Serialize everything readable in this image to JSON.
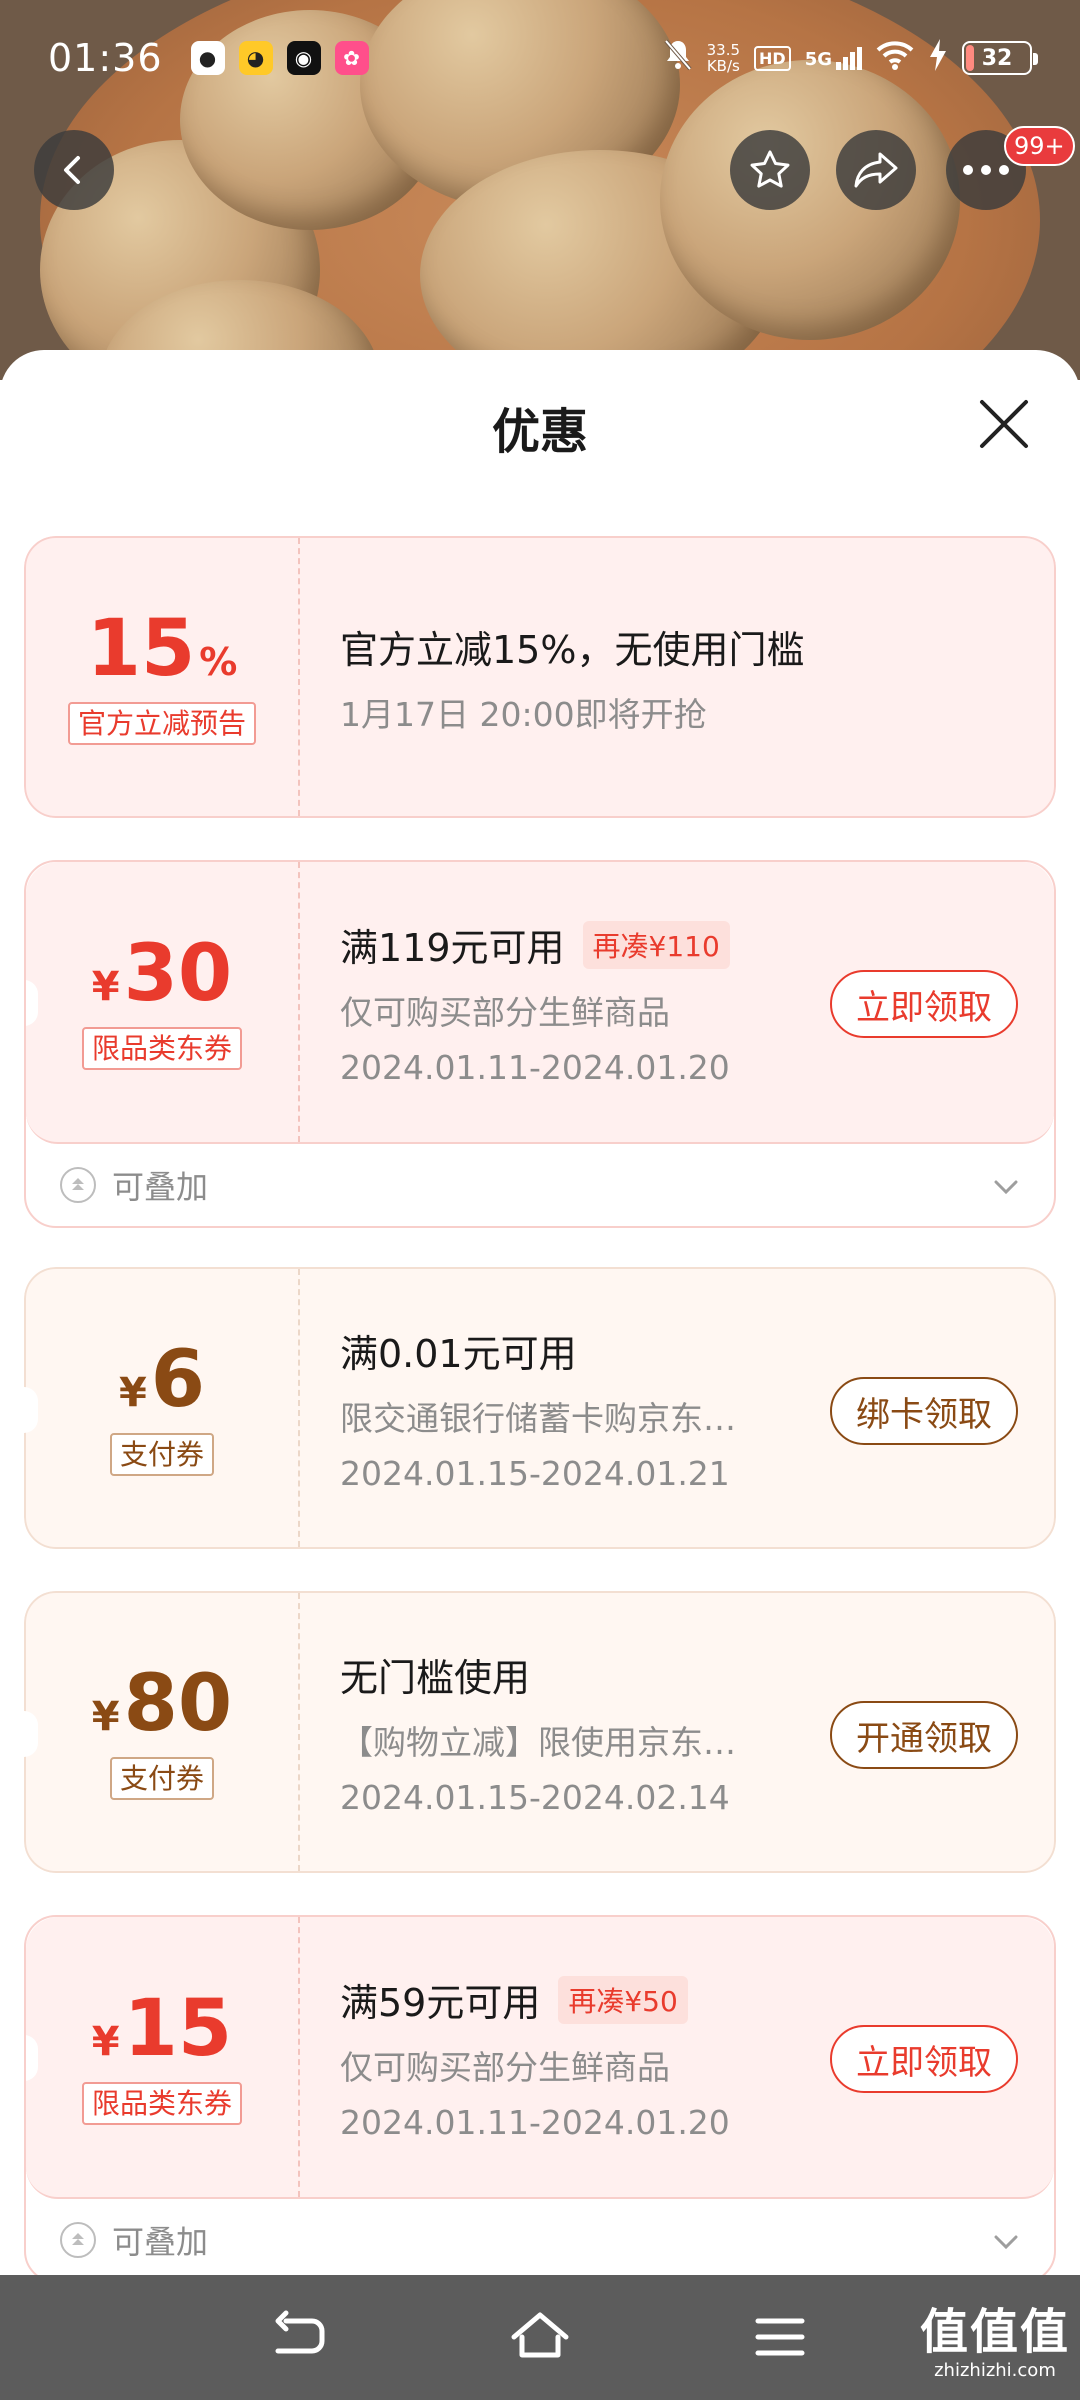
{
  "status_bar": {
    "time": "01:36",
    "net_speed_value": "33.5",
    "net_speed_unit": "KB/s",
    "hd": "HD",
    "signal": "5G",
    "battery": "32"
  },
  "header": {
    "notification_badge": "99+"
  },
  "sheet": {
    "title": "优惠"
  },
  "coupons": [
    {
      "amount": "15",
      "suffix": "%",
      "tag": "官方立减预告",
      "title": "官方立减15%，无使用门槛",
      "line2": "1月17日 20:00即将开抢"
    },
    {
      "currency": "¥",
      "amount": "30",
      "tag": "限品类东券",
      "title": "满119元可用",
      "chip": "再凑¥110",
      "line2": "仅可购买部分生鲜商品",
      "line3": "2024.01.11-2024.01.20",
      "button": "立即领取",
      "stack": "可叠加"
    },
    {
      "currency": "¥",
      "amount": "6",
      "tag": "支付券",
      "title": "满0.01元可用",
      "line2": "限交通银行储蓄卡购京东…",
      "line3": "2024.01.15-2024.01.21",
      "button": "绑卡领取"
    },
    {
      "currency": "¥",
      "amount": "80",
      "tag": "支付券",
      "title": "无门槛使用",
      "line2": "【购物立减】限使用京东…",
      "line3": "2024.01.15-2024.02.14",
      "button": "开通领取"
    },
    {
      "currency": "¥",
      "amount": "15",
      "tag": "限品类东券",
      "title": "满59元可用",
      "chip": "再凑¥50",
      "line2": "仅可购买部分生鲜商品",
      "line3": "2024.01.11-2024.01.20",
      "button": "立即领取",
      "stack": "可叠加"
    }
  ],
  "watermark": {
    "big": "值值值",
    "small": "zhizhizhi.com"
  },
  "colors": {
    "accent_red": "#e93b2d",
    "accent_brown": "#8a4a14"
  }
}
